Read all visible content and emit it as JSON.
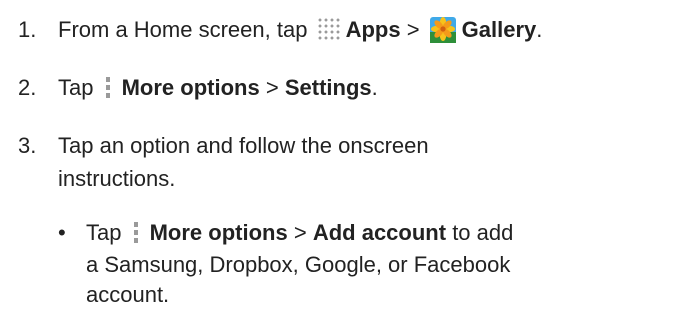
{
  "steps": [
    {
      "num": "1.",
      "t1": "From a Home screen, tap",
      "apps": "Apps",
      "sep": ">",
      "gallery": "Gallery",
      "period": "."
    },
    {
      "num": "2.",
      "t1": "Tap",
      "more": "More options",
      "sep": ">",
      "settings": "Settings",
      "period": "."
    },
    {
      "num": "3.",
      "line1": "Tap an option and follow the onscreen",
      "line2": "instructions."
    }
  ],
  "bullet": {
    "dot": "•",
    "t1": "Tap",
    "more": "More options",
    "sep": ">",
    "add": "Add account",
    "t2": "to add",
    "line2": "a Samsung, Dropbox, Google, or Facebook",
    "line3": "account."
  },
  "icons": {
    "apps": "apps-grid-icon",
    "more": "more-options-icon",
    "gallery": "gallery-icon"
  }
}
